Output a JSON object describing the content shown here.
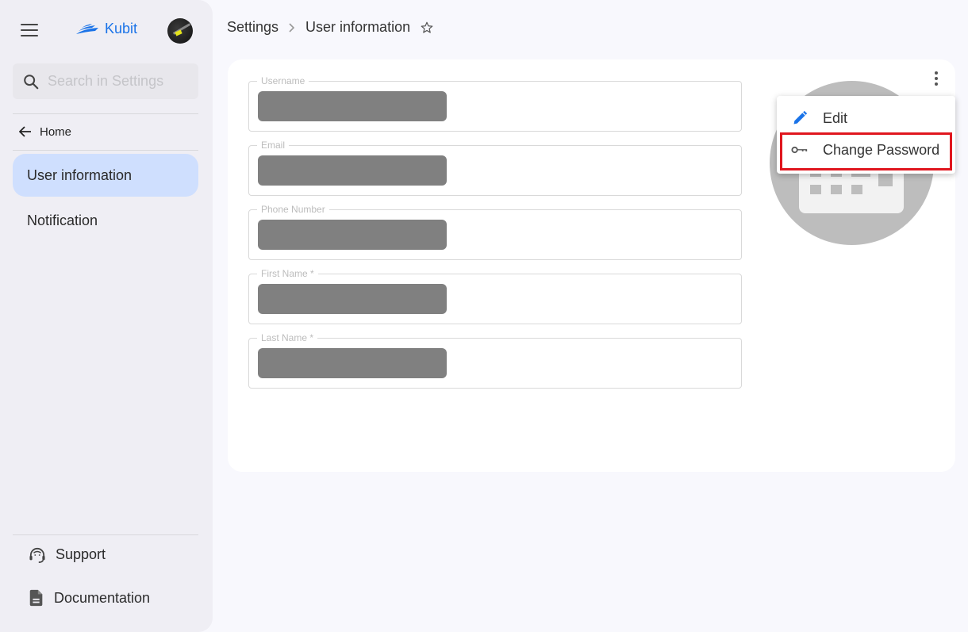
{
  "sidebar": {
    "brand": "Kubit",
    "search_placeholder": "Search in Settings",
    "home_label": "Home",
    "nav_items": [
      {
        "label": "User information",
        "active": true
      },
      {
        "label": "Notification",
        "active": false
      }
    ],
    "bottom_items": [
      {
        "label": "Support",
        "icon": "headset-icon"
      },
      {
        "label": "Documentation",
        "icon": "document-icon"
      }
    ]
  },
  "breadcrumb": {
    "items": [
      "Settings",
      "User information"
    ],
    "separator": ">"
  },
  "form": {
    "fields": [
      {
        "label": "Username",
        "value": "[redacted]"
      },
      {
        "label": "Email",
        "value": "[redacted]"
      },
      {
        "label": "Phone Number",
        "value": "[redacted]"
      },
      {
        "label": "First Name *",
        "value": "[redacted]"
      },
      {
        "label": "Last Name *",
        "value": "[redacted]"
      }
    ]
  },
  "context_menu": {
    "items": [
      {
        "label": "Edit",
        "icon": "pencil-icon"
      },
      {
        "label": "Change Password",
        "icon": "key-icon",
        "highlighted": true
      }
    ]
  },
  "colors": {
    "accent": "#1a73e8",
    "active_nav": "#cfdffe",
    "highlight_border": "#e0161e"
  }
}
